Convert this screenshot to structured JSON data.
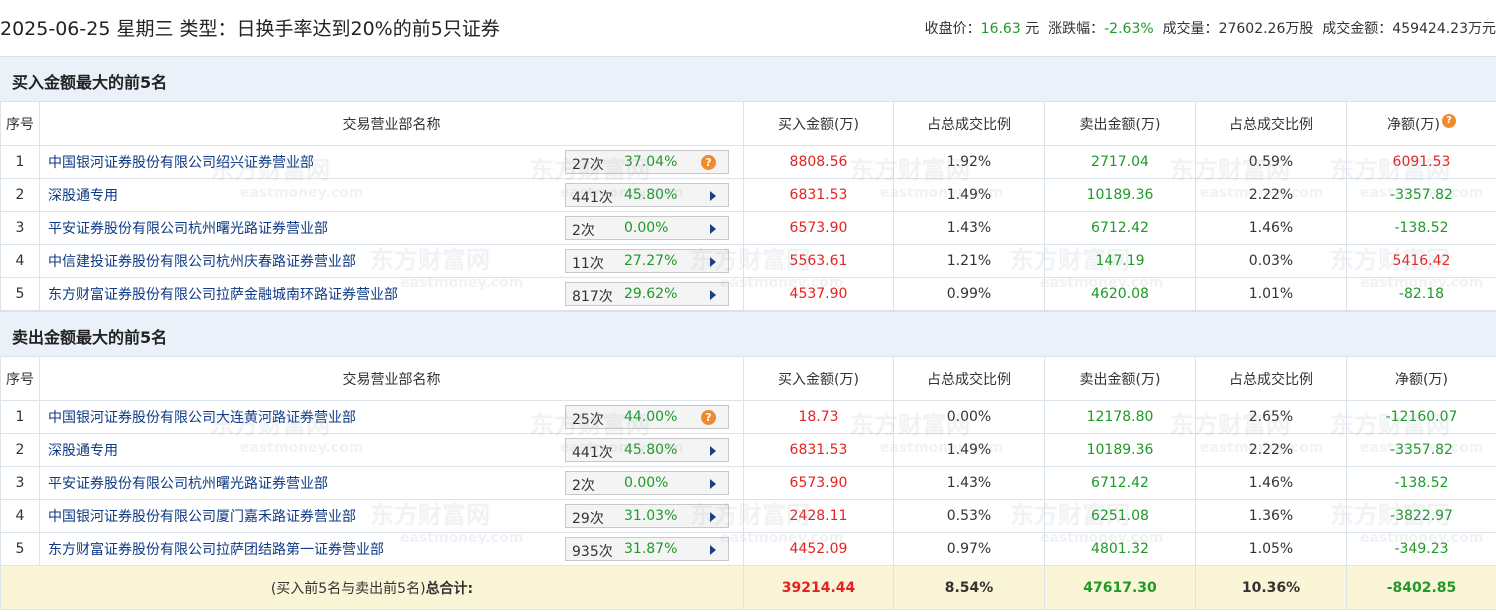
{
  "header": {
    "title": "2025-06-25 星期三 类型：日换手率达到20%的前5只证券",
    "close_label": "收盘价：",
    "close_value": "16.63",
    "close_unit": "元",
    "change_label": "涨跌幅：",
    "change_value": "-2.63%",
    "volume_label": "成交量：",
    "volume_value": "27602.26万股",
    "amount_label": "成交金额：",
    "amount_value": "459424.23万元"
  },
  "columns": {
    "no": "序号",
    "name": "交易营业部名称",
    "buy": "买入金额(万)",
    "buy_pct": "占总成交比例",
    "sell": "卖出金额(万)",
    "sell_pct": "占总成交比例",
    "net": "净额(万)"
  },
  "buy_section": {
    "title": "买入金额最大的前5名",
    "rows": [
      {
        "no": "1",
        "name": "中国银河证券股份有限公司绍兴证券营业部",
        "times": "27次",
        "rate": "37.04%",
        "buy": "8808.56",
        "buy_pct": "1.92%",
        "sell": "2717.04",
        "sell_pct": "0.59%",
        "net": "6091.53"
      },
      {
        "no": "2",
        "name": "深股通专用",
        "times": "441次",
        "rate": "45.80%",
        "buy": "6831.53",
        "buy_pct": "1.49%",
        "sell": "10189.36",
        "sell_pct": "2.22%",
        "net": "-3357.82"
      },
      {
        "no": "3",
        "name": "平安证券股份有限公司杭州曙光路证券营业部",
        "times": "2次",
        "rate": "0.00%",
        "buy": "6573.90",
        "buy_pct": "1.43%",
        "sell": "6712.42",
        "sell_pct": "1.46%",
        "net": "-138.52"
      },
      {
        "no": "4",
        "name": "中信建投证券股份有限公司杭州庆春路证券营业部",
        "times": "11次",
        "rate": "27.27%",
        "buy": "5563.61",
        "buy_pct": "1.21%",
        "sell": "147.19",
        "sell_pct": "0.03%",
        "net": "5416.42"
      },
      {
        "no": "5",
        "name": "东方财富证券股份有限公司拉萨金融城南环路证券营业部",
        "times": "817次",
        "rate": "29.62%",
        "buy": "4537.90",
        "buy_pct": "0.99%",
        "sell": "4620.08",
        "sell_pct": "1.01%",
        "net": "-82.18"
      }
    ]
  },
  "sell_section": {
    "title": "卖出金额最大的前5名",
    "rows": [
      {
        "no": "1",
        "name": "中国银河证券股份有限公司大连黄河路证券营业部",
        "times": "25次",
        "rate": "44.00%",
        "buy": "18.73",
        "buy_pct": "0.00%",
        "sell": "12178.80",
        "sell_pct": "2.65%",
        "net": "-12160.07"
      },
      {
        "no": "2",
        "name": "深股通专用",
        "times": "441次",
        "rate": "45.80%",
        "buy": "6831.53",
        "buy_pct": "1.49%",
        "sell": "10189.36",
        "sell_pct": "2.22%",
        "net": "-3357.82"
      },
      {
        "no": "3",
        "name": "平安证券股份有限公司杭州曙光路证券营业部",
        "times": "2次",
        "rate": "0.00%",
        "buy": "6573.90",
        "buy_pct": "1.43%",
        "sell": "6712.42",
        "sell_pct": "1.46%",
        "net": "-138.52"
      },
      {
        "no": "4",
        "name": "中国银河证券股份有限公司厦门嘉禾路证券营业部",
        "times": "29次",
        "rate": "31.03%",
        "buy": "2428.11",
        "buy_pct": "0.53%",
        "sell": "6251.08",
        "sell_pct": "1.36%",
        "net": "-3822.97"
      },
      {
        "no": "5",
        "name": "东方财富证券股份有限公司拉萨团结路第一证券营业部",
        "times": "935次",
        "rate": "31.87%",
        "buy": "4452.09",
        "buy_pct": "0.97%",
        "sell": "4801.32",
        "sell_pct": "1.05%",
        "net": "-349.23"
      }
    ]
  },
  "total": {
    "label_prefix": "(买入前5名与卖出前5名)",
    "label_strong": "总合计:",
    "buy": "39214.44",
    "buy_pct": "8.54%",
    "sell": "47617.30",
    "sell_pct": "10.36%",
    "net": "-8402.85"
  },
  "watermark": {
    "cn": "东方财富网",
    "en": "eastmoney.com"
  },
  "colors": {
    "up": "#e52222",
    "down": "#1e9a28",
    "link": "#0f3a86",
    "section_bg": "#eaf1f8",
    "total_bg": "#fbf5d8"
  }
}
